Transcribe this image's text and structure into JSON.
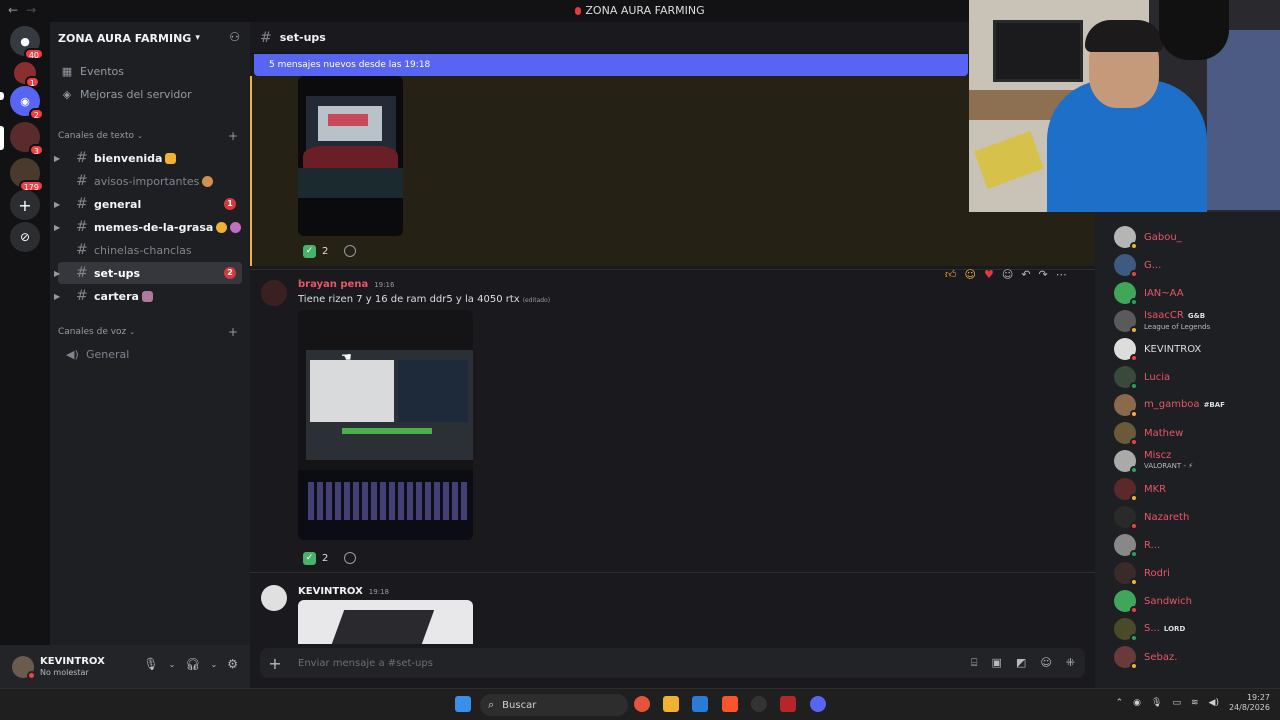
{
  "window": {
    "title": "ZONA AURA FARMING",
    "back": "←",
    "forward": "→"
  },
  "rail": {
    "badges": [
      "40",
      "1",
      "2",
      "3",
      "179"
    ]
  },
  "server": {
    "name": "ZONA AURA FARMING"
  },
  "sidebar": {
    "top_items": [
      {
        "label": "Eventos"
      },
      {
        "label": "Mejoras del servidor"
      }
    ],
    "text_category": "Canales de texto",
    "channels": [
      {
        "name": "bienvenida"
      },
      {
        "name": "avisos-importantes"
      },
      {
        "name": "general",
        "mentions": "1"
      },
      {
        "name": "memes-de-la-grasa"
      },
      {
        "name": "chinelas-chanclas"
      },
      {
        "name": "set-ups",
        "mentions": "2"
      },
      {
        "name": "cartera"
      }
    ],
    "voice_category": "Canales de voz",
    "voice_channels": [
      {
        "name": "General"
      }
    ]
  },
  "user": {
    "name": "KEVINTROX",
    "status": "No molestar"
  },
  "chat": {
    "channel": "set-ups",
    "new_messages_banner": "5 mensajes nuevos desde las 19:18",
    "messages": [
      {
        "reaction_count": "2"
      },
      {
        "author": "brayan pena",
        "time": "19:16",
        "text": "Tiene rizen 7 y 16 de ram ddr5 y la 4050 rtx",
        "edited": "(editado)",
        "reaction_count": "2"
      },
      {
        "author": "KEVINTROX",
        "time": "19:18"
      }
    ],
    "composer_placeholder": "Enviar mensaje a #set-ups"
  },
  "members": [
    {
      "name": "Gabou_",
      "color": "#e9556a"
    },
    {
      "name": "G...",
      "color": "#e9556a"
    },
    {
      "name": "IAN~AA",
      "color": "#e9556a"
    },
    {
      "name": "IsaacCR",
      "color": "#e9556a",
      "tag": "G&B",
      "activity": "League of Legends"
    },
    {
      "name": "KEVINTROX",
      "color": "#dbdee1"
    },
    {
      "name": "Lucia",
      "color": "#e9556a"
    },
    {
      "name": "m_gamboa",
      "color": "#e9556a",
      "tag": "#BAF"
    },
    {
      "name": "Mathew",
      "color": "#e9556a"
    },
    {
      "name": "Miscz",
      "color": "#e9556a",
      "activity": "VALORANT - ⚡"
    },
    {
      "name": "MKR",
      "color": "#e9556a"
    },
    {
      "name": "Nazareth",
      "color": "#e9556a"
    },
    {
      "name": "R...",
      "color": "#e9556a"
    },
    {
      "name": "Rodri",
      "color": "#e9556a"
    },
    {
      "name": "Sandwich",
      "color": "#e9556a"
    },
    {
      "name": "S...",
      "color": "#e9556a",
      "tag": "LORD"
    },
    {
      "name": "Sebaz.",
      "color": "#e9556a"
    }
  ],
  "taskbar": {
    "search_label": "Buscar",
    "time": "19:27",
    "date": "24/8/2026"
  },
  "colors": {
    "accent": "#5865f2",
    "mention": "#da373c",
    "role": "#e9556a"
  }
}
